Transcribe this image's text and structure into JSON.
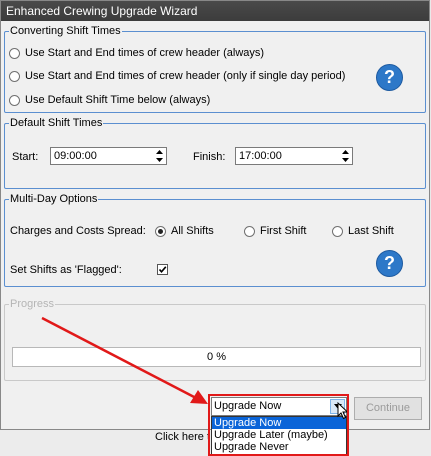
{
  "window": {
    "title": "Enhanced Crewing Upgrade Wizard"
  },
  "converting": {
    "legend": "Converting Shift Times",
    "options": [
      "Use Start and End times of crew header (always)",
      "Use Start and End times of crew header (only if single day period)",
      "Use Default Shift Time below (always)"
    ],
    "help": "?"
  },
  "defaults": {
    "legend": "Default Shift Times",
    "start_label": "Start:",
    "start_value": "09:00:00",
    "finish_label": "Finish:",
    "finish_value": "17:00:00"
  },
  "multiday": {
    "legend": "Multi-Day Options",
    "spread_label": "Charges and Costs Spread:",
    "spread_options": [
      "All Shifts",
      "First Shift",
      "Last Shift"
    ],
    "spread_selected": "All Shifts",
    "flagged_label": "Set Shifts as 'Flagged':",
    "flagged_checked": true,
    "help": "?"
  },
  "progress": {
    "legend": "Progress",
    "value_text": "0 %",
    "fraction": 0
  },
  "action": {
    "selected": "Upgrade Now",
    "options": [
      "Upgrade Now",
      "Upgrade Later (maybe)",
      "Upgrade Never"
    ],
    "continue_label": "Continue"
  },
  "background": {
    "text": "Click here t"
  },
  "annotation": {
    "color": "#e11919"
  }
}
